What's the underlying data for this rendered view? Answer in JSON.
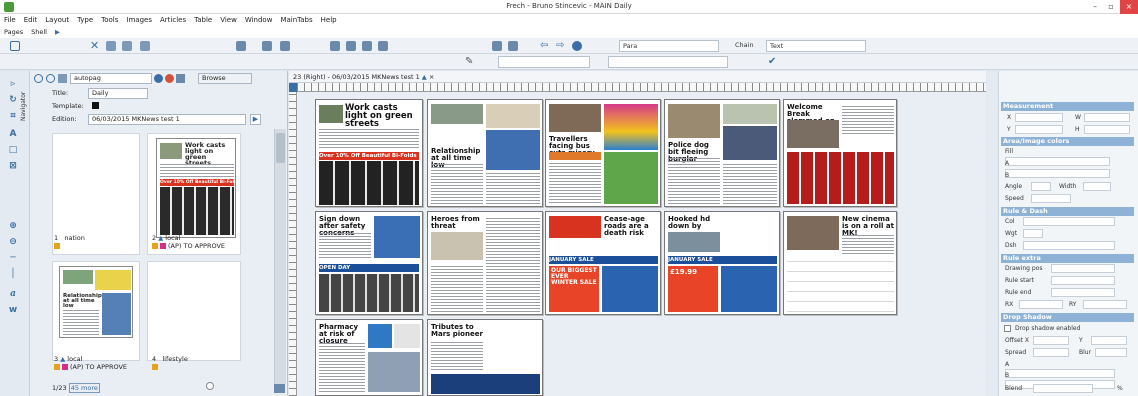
{
  "window": {
    "title": "Frech - Bruno Stincevic - MAIN Daily"
  },
  "menu": [
    "File",
    "Edit",
    "Layout",
    "Type",
    "Tools",
    "Images",
    "Articles",
    "Table",
    "View",
    "Window",
    "MainTabs",
    "Help"
  ],
  "pages_bar": {
    "pages": "Pages",
    "shell": "Shell"
  },
  "toolbar": {
    "style_field": "Para",
    "chain_field": "Chain",
    "text_field": "Text"
  },
  "navigator": {
    "tab_label": "Navigator",
    "search_value": "autopag",
    "browse_label": "Browse",
    "title_label": "Title:",
    "title_value": "Daily",
    "template_label": "Template:",
    "edition_label": "Edition:",
    "edition_value": "06/03/2015 MKNews test 1",
    "pages": [
      {
        "num": "1",
        "section": "nation",
        "status": ""
      },
      {
        "num": "2",
        "section": "local",
        "status": "(AP) TO APPROVE"
      },
      {
        "num": "3",
        "section": "local",
        "status": "(AP) TO APPROVE"
      },
      {
        "num": "4",
        "section": "lifestyle",
        "status": ""
      }
    ],
    "thumb2_headline": "Work casts light on green streets",
    "thumb2_ad": "Over 10% Off Beautiful Bi-Folds",
    "thumb3_headline": "Relationship at all time low",
    "footer_count": "1/23",
    "footer_more": "45 more"
  },
  "document": {
    "tab_title": "23 (Right) - 06/03/2015 MKNews test 1",
    "headlines": [
      "Work casts light on green streets",
      "Relationship at all time low",
      "Travellers facing bus cuts misery",
      "Police dog bit fleeing burglar",
      "Welcome Break slammed on pay",
      "Sign down after safety concerns",
      "Heroes from threat",
      "Cease-age roads are a death risk",
      "Hooked hd down by",
      "New cinema is on a roll at MK!",
      "Pharmacy at risk of closure",
      "Tributes to Mars pioneer"
    ],
    "ad_texts": [
      "Over 10% Off Beautiful Bi-Folds",
      "OPEN DAY",
      "JANUARY SALE",
      "OUR BIGGEST EVER WINTER SALE",
      "JANUARY SALE",
      "£19.99",
      "£19.99"
    ]
  },
  "properties": {
    "sections": [
      {
        "title": "Measurement",
        "fields": [
          "X",
          "W",
          "Y",
          "H"
        ]
      },
      {
        "title": "Area/Image colors",
        "fields": [
          "Fill",
          "A",
          "B",
          "Angle",
          "Width",
          "Speed"
        ]
      },
      {
        "title": "Rule & Dash",
        "fields": [
          "Col",
          "Wgt",
          "Dsh"
        ]
      },
      {
        "title": "Rule extra",
        "fields": [
          "Drawing pos",
          "Rule start",
          "Rule end",
          "RX",
          "RY"
        ]
      },
      {
        "title": "Drop Shadow",
        "fields": [
          "Drop shadow enabled",
          "Offset X",
          "Y",
          "Spread",
          "Blur",
          "A",
          "B",
          "Blend",
          "%"
        ]
      }
    ]
  },
  "colors": {
    "accent": "#3a6ea5",
    "section_header": "#8eb1d6",
    "close": "#e04343"
  }
}
